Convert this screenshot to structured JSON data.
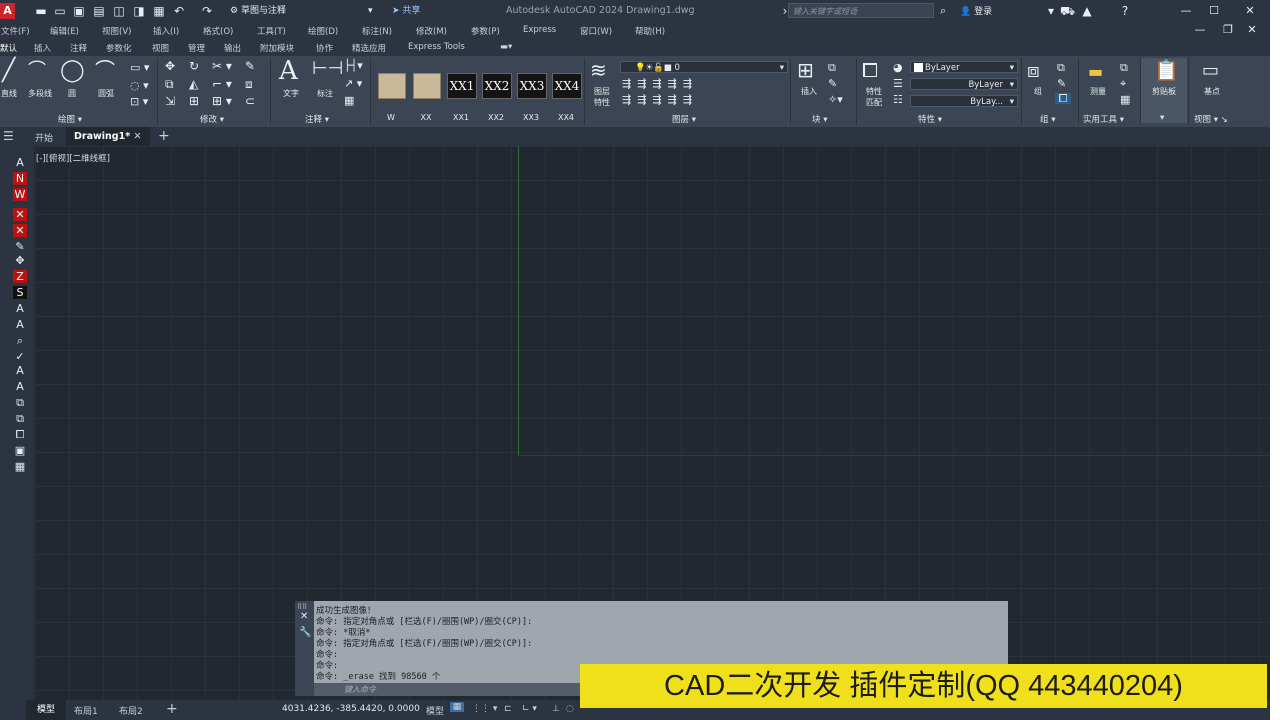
{
  "titlebar": {
    "logo": "A",
    "workspace": "草图与注释",
    "share": "共享",
    "app_title": "Autodesk AutoCAD 2024    Drawing1.dwg",
    "search_placeholder": "键入关键字或短语",
    "login": "登录"
  },
  "menus": [
    "文件(F)",
    "编辑(E)",
    "视图(V)",
    "插入(I)",
    "格式(O)",
    "工具(T)",
    "绘图(D)",
    "标注(N)",
    "修改(M)",
    "参数(P)",
    "Express",
    "窗口(W)",
    "帮助(H)"
  ],
  "ribbon_tabs": [
    "默认",
    "插入",
    "注释",
    "参数化",
    "视图",
    "管理",
    "输出",
    "附加模块",
    "协作",
    "精选应用",
    "Express Tools"
  ],
  "ribbon": {
    "draw": {
      "line": "直线",
      "polyline": "多段线",
      "circle": "圆",
      "arc": "圆弧",
      "panel": "绘图"
    },
    "modify": {
      "panel": "修改"
    },
    "annotation": {
      "text": "文字",
      "dimension": "标注",
      "panel": "注释"
    },
    "blocks": [
      "W",
      "XX",
      "XX1",
      "XX2",
      "XX3",
      "XX4"
    ],
    "layers": {
      "props": "图层\n特性",
      "current_layer": "0",
      "panel": "图层"
    },
    "block": {
      "insert": "插入",
      "panel": "块"
    },
    "properties": {
      "match": "特性\n匹配",
      "color": "ByLayer",
      "linetype": "ByLayer",
      "lineweight": "ByLay...",
      "panel": "特性"
    },
    "groups": {
      "group": "组",
      "panel": "组"
    },
    "utilities": {
      "measure": "测量",
      "panel": "实用工具"
    },
    "clipboard": {
      "paste": "剪贴板"
    },
    "view": {
      "base": "基点",
      "panel": "视图"
    }
  },
  "file_tabs": {
    "start": "开始",
    "drawing": "Drawing1*"
  },
  "viewport_label": "[-][俯视][二维线框]",
  "command_history": [
    "成功生成图像！",
    "命令: 指定对角点或 [栏选(F)/圈围(WP)/圈交(CP)]:",
    "命令: *取消*",
    "命令: 指定对角点或 [栏选(F)/圈围(WP)/圈交(CP)]:",
    "命令:",
    "命令:",
    "命令: _erase 找到 98560 个"
  ],
  "command_placeholder": "键入命令",
  "banner": "CAD二次开发 插件定制(QQ 443440204)",
  "status": {
    "model_tab": "模型",
    "layout1": "布局1",
    "layout2": "布局2",
    "coords": "4031.4236, -385.4420, 0.0000",
    "mode": "模型"
  },
  "colors": {
    "banner_bg": "#f0e01c",
    "canvas_bg": "#212830",
    "accent": "#c9252b"
  }
}
